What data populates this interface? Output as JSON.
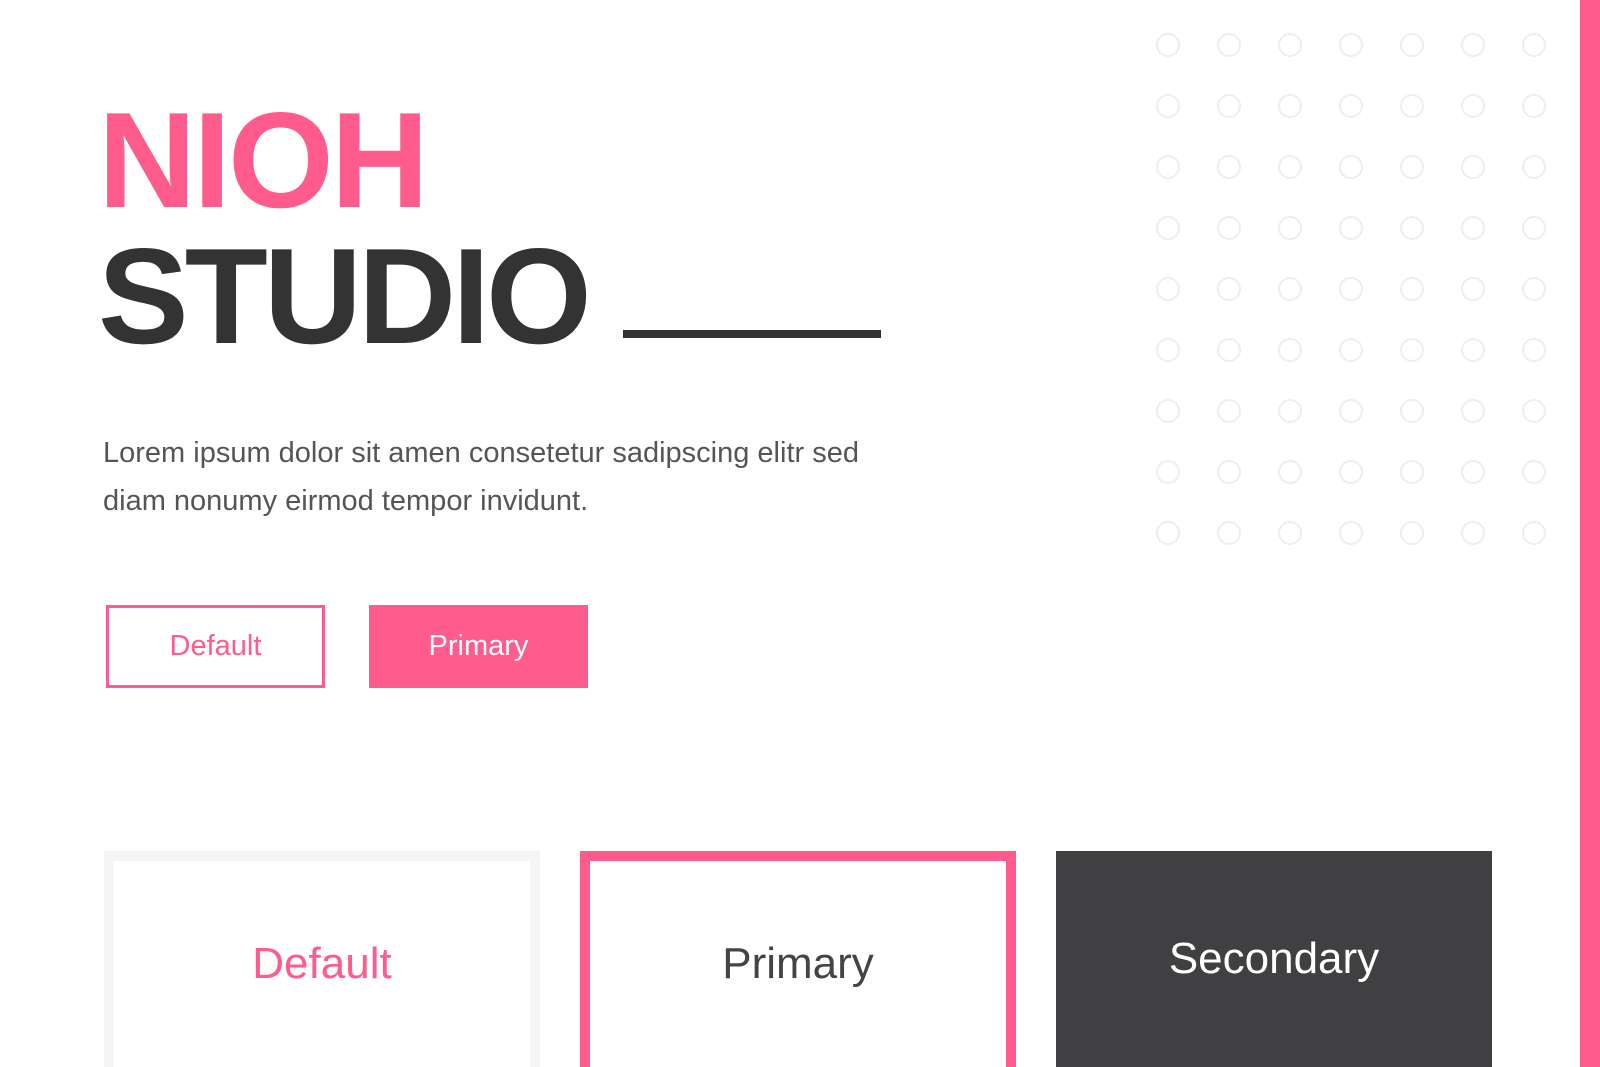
{
  "brand": {
    "line1": "NIOH",
    "line2": "STUDIO"
  },
  "hero": {
    "description": "Lorem ipsum dolor sit amen consetetur sadipscing elitr sed diam nonumy eirmod tempor invidunt.",
    "buttons": {
      "default_label": "Default",
      "primary_label": "Primary"
    }
  },
  "cards": {
    "default_label": "Default",
    "primary_label": "Primary",
    "secondary_label": "Secondary"
  },
  "colors": {
    "accent": "#ff5c8d",
    "dark": "#333333",
    "secondary_card": "#404042",
    "text": "#555555",
    "dot_outline": "#eeeeee"
  },
  "decorations": {
    "dot_grid_rows": 9,
    "dot_grid_cols": 7
  }
}
